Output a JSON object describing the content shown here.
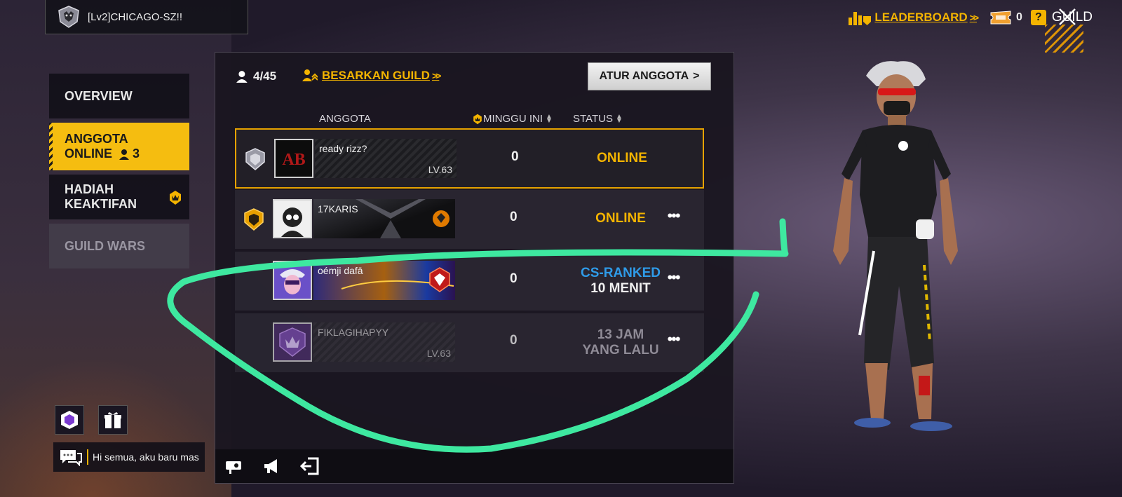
{
  "header": {
    "player_name": "[Lv2]CHICAGO-SZ!!",
    "leaderboard_label": "LEADERBOARD",
    "ticket_count": "0",
    "guild_label": "GUILD",
    "question_mark": "?"
  },
  "sidebar": {
    "items": [
      {
        "label": "OVERVIEW"
      },
      {
        "label_line1": "ANGGOTA",
        "label_line2": "ONLINE",
        "online_count": "3"
      },
      {
        "label_line1": "HADIAH",
        "label_line2": "KEAKTIFAN"
      },
      {
        "label": "GUILD WARS"
      }
    ]
  },
  "panel": {
    "member_count": "4/45",
    "grow_guild_label": "BESARKAN GUILD",
    "manage_label": "ATUR ANGGOTA",
    "columns": {
      "member": "ANGGOTA",
      "this_week": "MINGGU INI",
      "status": "STATUS"
    }
  },
  "members": [
    {
      "name": "ready rizz?",
      "level": "LV.63",
      "week": "0",
      "status": "ONLINE"
    },
    {
      "name": "17KARIS",
      "week": "0",
      "status": "ONLINE"
    },
    {
      "name": "oémji  dafā",
      "week": "0",
      "status_line1": "CS-RANKED",
      "status_line2": "10 MENIT"
    },
    {
      "name": "FIKLAGIHAPYY",
      "level": "LV.63",
      "week": "0",
      "status_line1": "13 JAM",
      "status_line2": "YANG LALU"
    }
  ],
  "chat": {
    "preview": "Hi semua, aku baru mas"
  },
  "colors": {
    "accent": "#f4b400",
    "online": "#f4b400",
    "in_game": "#2f9be8",
    "offline": "#8f8b96",
    "annotation": "#3ee8a0"
  },
  "icons": [
    "guild-emblem-icon",
    "leaderboard-icon",
    "ticket-icon",
    "close-icon",
    "members-icon",
    "grow-guild-icon",
    "crown-icon",
    "sort-icon",
    "leader-badge-icon",
    "officer-badge-icon",
    "more-options-icon",
    "camera-icon",
    "megaphone-icon",
    "exit-icon",
    "guild-shop-icon",
    "gift-icon",
    "chat-icon"
  ]
}
